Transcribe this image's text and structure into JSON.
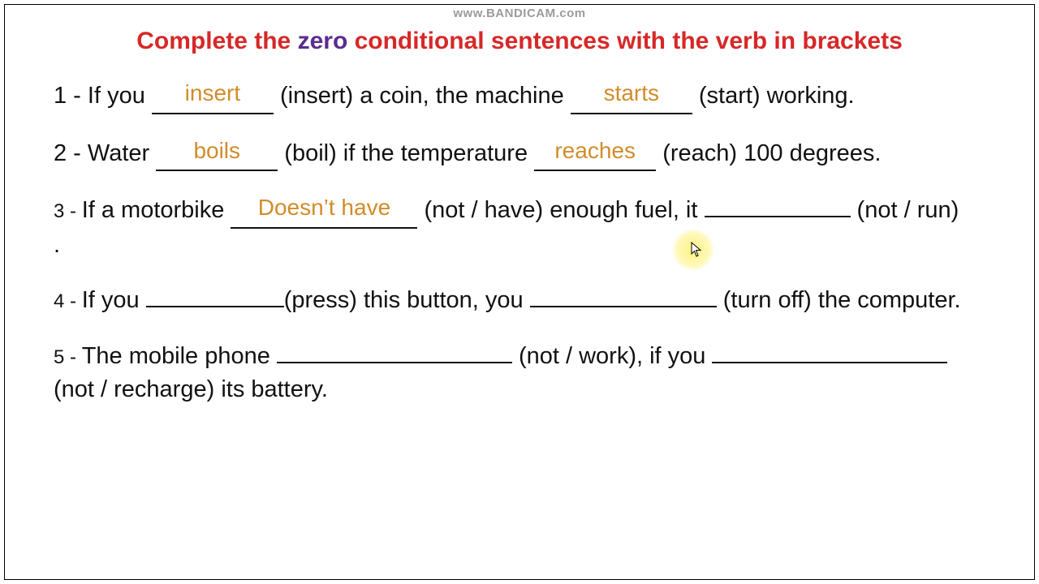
{
  "watermark": "www.BANDICAM.com",
  "title": {
    "before": "Complete the ",
    "highlight": "zero",
    "after": " conditional sentences with the verb in brackets"
  },
  "items": {
    "1": {
      "num": "1 - ",
      "t1": "If you ",
      "ans1": "insert",
      "t2": " (insert) a coin, the machine ",
      "ans2": "starts",
      "t3": " (start) working."
    },
    "2": {
      "num": "2 - ",
      "t1": "Water ",
      "ans1": "boils",
      "t2": " (boil) if the temperature ",
      "ans2": "reaches",
      "t3": " (reach) 100 degrees."
    },
    "3": {
      "num": "3 - ",
      "t1": "If a motorbike ",
      "ans1": "Doesn’t have",
      "t2": " (not / have) enough fuel, it ",
      "t3": " (not / run)",
      "t4": "."
    },
    "4": {
      "num": "4 - ",
      "t1": "If you ",
      "t2": "(press) this button, you ",
      "t3": " (turn off) the computer."
    },
    "5": {
      "num": "5 - ",
      "t1": "The mobile phone ",
      "t2": " (not / work), if you ",
      "t3": " (not / recharge) its battery."
    }
  }
}
